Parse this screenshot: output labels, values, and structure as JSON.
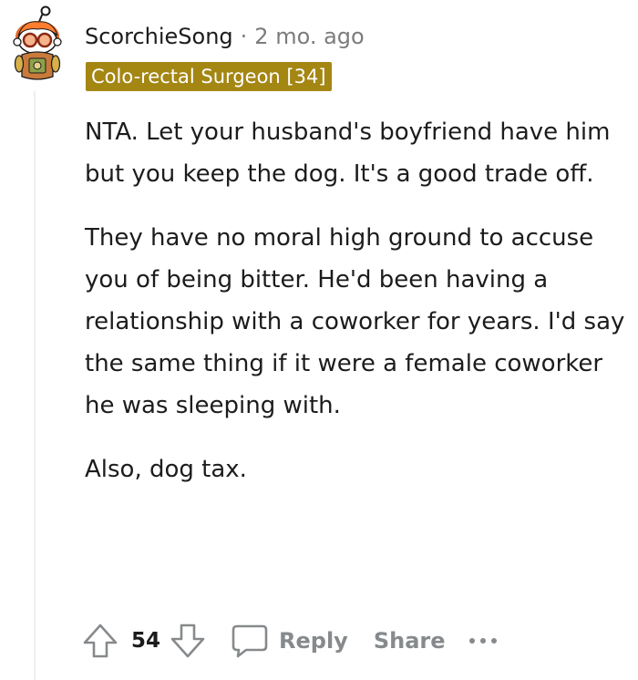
{
  "comment": {
    "username": "ScorchieSong",
    "separator": "·",
    "timestamp": "2 mo. ago",
    "flair": "Colo-rectal Surgeon [34]",
    "flair_color": "#a48613",
    "avatar_icon": "snoo-avatar",
    "paragraphs": [
      "NTA. Let your husband's boyfriend have him but you keep the dog. It's a good trade off.",
      "They have no moral high ground to accuse you of being bitter. He'd been having a relationship with a coworker for years. I'd say the same thing if it were a female coworker he was sleeping with.",
      "Also, dog tax."
    ]
  },
  "actions": {
    "upvote_icon": "upvote-arrow-icon",
    "vote_count": "54",
    "downvote_icon": "downvote-arrow-icon",
    "reply_icon": "speech-bubble-icon",
    "reply_label": "Reply",
    "share_label": "Share",
    "more_icon": "ellipsis-icon"
  }
}
